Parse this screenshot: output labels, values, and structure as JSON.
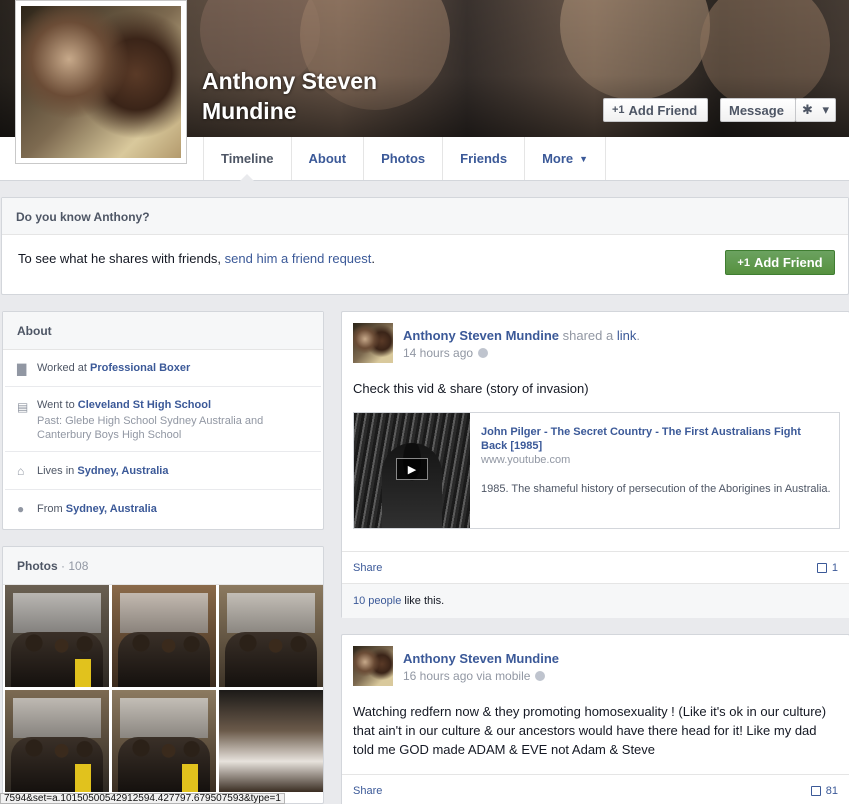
{
  "profile": {
    "name": "Anthony Steven Mundine"
  },
  "cover_buttons": {
    "add_friend": "Add Friend",
    "message": "Message",
    "gear_icon": "gear-icon",
    "caret": "▾"
  },
  "tabs": [
    {
      "label": "Timeline",
      "active": true
    },
    {
      "label": "About"
    },
    {
      "label": "Photos"
    },
    {
      "label": "Friends"
    },
    {
      "label": "More"
    }
  ],
  "know_panel": {
    "title": "Do you know Anthony?",
    "text_before": "To see what he shares with friends, ",
    "link": "send him a friend request",
    "text_after": ".",
    "button": "Add Friend"
  },
  "about": {
    "title": "About",
    "items": [
      {
        "icon": "briefcase-icon",
        "prefix": "Worked at ",
        "value": "Professional Boxer"
      },
      {
        "icon": "school-icon",
        "prefix": "Went to ",
        "value": "Cleveland St High School",
        "sub": "Past: Glebe High School Sydney Australia and Canterbury Boys High School"
      },
      {
        "icon": "home-icon",
        "prefix": "Lives in ",
        "value": "Sydney, Australia"
      },
      {
        "icon": "map-pin-icon",
        "prefix": "From ",
        "value": "Sydney, Australia"
      }
    ]
  },
  "photos": {
    "title": "Photos",
    "count": "· 108"
  },
  "posts": [
    {
      "author": "Anthony Steven Mundine",
      "action_prefix": " shared a ",
      "action_link": "link",
      "action_suffix": ".",
      "time": "14 hours ago",
      "text": "Check this vid & share (story of invasion)",
      "share": {
        "title": "John Pilger - The Secret Country - The First Australians Fight Back [1985]",
        "domain": "www.youtube.com",
        "description": "1985. The shameful history of persecution of the Aborigines in Australia."
      },
      "share_label": "Share",
      "comments": "1",
      "likes_link": "10 people",
      "likes_suffix": " like this."
    },
    {
      "author": "Anthony Steven Mundine",
      "time": "16 hours ago via mobile",
      "text": "Watching redfern now & they promoting homosexuality ! (Like it's ok in our culture) that ain't in our culture & our ancestors would have there head for it! Like my dad told me GOD made ADAM & EVE not Adam & Steve",
      "share_label": "Share",
      "comments": "81"
    }
  ],
  "status_bar": "7594&set=a.10150500542912594.427797.679507593&type=1"
}
